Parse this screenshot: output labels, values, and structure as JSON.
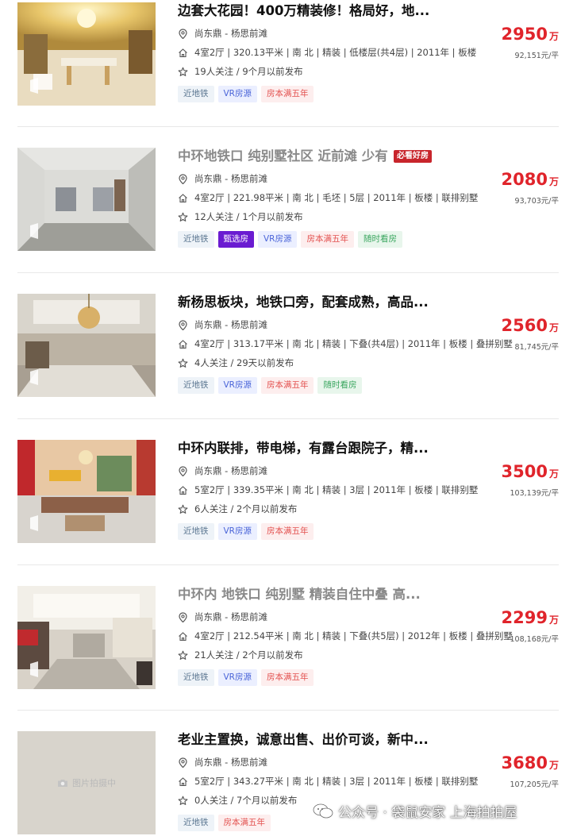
{
  "listings": [
    {
      "title": "边套大花园！400万精装修！格局好，地...",
      "location": "尚东鼎 - 杨思前滩",
      "details": "4室2厅 | 320.13平米 | 南 北 | 精装 | 低楼层(共4层) | 2011年 | 板楼",
      "followers": "19人关注 / 9个月以前发布",
      "price_total": "2950",
      "price_unit": "万",
      "price_per": "92,151元/平",
      "tags": [
        "近地铁",
        "VR房源",
        "房本满五年"
      ]
    },
    {
      "title": "中环地铁口 纯别墅社区 近前滩 少有中叠...",
      "badge": "必看好房",
      "location": "尚东鼎 - 杨思前滩",
      "details": "4室2厅 | 221.98平米 | 南 北 | 毛坯 | 5层 | 2011年 | 板楼 | 联排别墅",
      "followers": "12人关注 / 1个月以前发布",
      "price_total": "2080",
      "price_unit": "万",
      "price_per": "93,703元/平",
      "tags": [
        "近地铁",
        "甄选房",
        "VR房源",
        "房本满五年",
        "随时看房"
      ]
    },
    {
      "title": "新杨思板块，地铁口旁，配套成熟，高品...",
      "location": "尚东鼎 - 杨思前滩",
      "details": "4室2厅 | 313.17平米 | 南 北 | 精装 | 下叠(共4层) | 2011年 | 板楼 | 叠拼别墅",
      "followers": "4人关注 / 29天以前发布",
      "price_total": "2560",
      "price_unit": "万",
      "price_per": "81,745元/平",
      "tags": [
        "近地铁",
        "VR房源",
        "房本满五年",
        "随时看房"
      ]
    },
    {
      "title": "中环内联排，带电梯，有露台跟院子，精...",
      "location": "尚东鼎 - 杨思前滩",
      "details": "5室2厅 | 339.35平米 | 南 北 | 精装 | 3层 | 2011年 | 板楼 | 联排别墅",
      "followers": "6人关注 / 2个月以前发布",
      "price_total": "3500",
      "price_unit": "万",
      "price_per": "103,139元/平",
      "tags": [
        "近地铁",
        "VR房源",
        "房本满五年"
      ]
    },
    {
      "title": "中环内 地铁口 纯别墅 精装自住中叠 高...",
      "location": "尚东鼎 - 杨思前滩",
      "details": "4室2厅 | 212.54平米 | 南 北 | 精装 | 下叠(共5层) | 2012年 | 板楼 | 叠拼别墅",
      "followers": "21人关注 / 2个月以前发布",
      "price_total": "2299",
      "price_unit": "万",
      "price_per": "108,168元/平",
      "tags": [
        "近地铁",
        "VR房源",
        "房本满五年"
      ]
    },
    {
      "title": "老业主置换，诚意出售、出价可谈，新中...",
      "location": "尚东鼎 - 杨思前滩",
      "details": "5室2厅 | 343.27平米 | 南 北 | 精装 | 3层 | 2011年 | 板楼 | 联排别墅",
      "followers": "0人关注 / 7个月以前发布",
      "price_total": "3680",
      "price_unit": "万",
      "price_per": "107,205元/平",
      "placeholder_text": "图片拍摄中",
      "tags": [
        "近地铁",
        "房本满五年"
      ]
    }
  ],
  "watermark": "公众号 · 袋鼠安家 上海拍拍屋",
  "colors": {
    "price": "#e0242b",
    "badge": "#c8252c",
    "select_tag": "#6a1bd1"
  }
}
